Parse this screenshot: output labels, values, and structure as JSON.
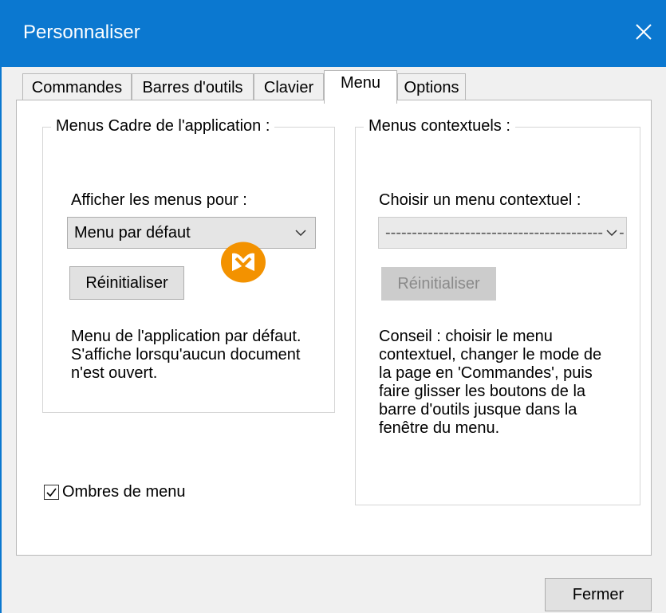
{
  "window": {
    "title": "Personnaliser",
    "close_icon": "close-icon",
    "accent_color": "#0b78d0"
  },
  "tabs": [
    {
      "label": "Commandes",
      "active": false
    },
    {
      "label": "Barres d'outils",
      "active": false
    },
    {
      "label": "Clavier",
      "active": false
    },
    {
      "label": "Menu",
      "active": true
    },
    {
      "label": "Options",
      "active": false
    }
  ],
  "app_menus": {
    "legend": "Menus Cadre de l'application :",
    "show_for_label": "Afficher les menus pour :",
    "selected_menu": "Menu par défaut",
    "reset_label": "Réinitialiser",
    "description_lines": [
      "Menu de l'application par défaut.",
      "S'affiche lorsqu'aucun document",
      "n'est ouvert."
    ]
  },
  "context_menus": {
    "legend": "Menus contextuels :",
    "choose_label": "Choisir un menu contextuel :",
    "selected_value": "-----------------------------------------------",
    "reset_label": "Réinitialiser",
    "reset_disabled": true,
    "tip_lines": [
      "Conseil : choisir le menu",
      "contextuel, changer le mode de",
      "la page en 'Commandes', puis",
      "faire glisser les boutons de la",
      "barre d'outils jusque dans la",
      "fenêtre du menu."
    ]
  },
  "menu_shadows": {
    "label": "Ombres de menu",
    "checked": true
  },
  "footer": {
    "close_label": "Fermer"
  },
  "logo": {
    "icon": "altova-m-logo-icon",
    "color": "#f39200"
  }
}
